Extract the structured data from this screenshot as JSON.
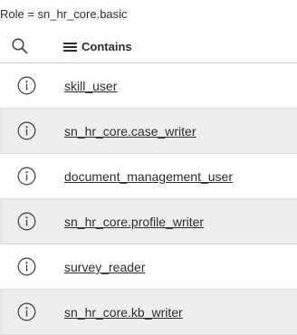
{
  "breadcrumb": {
    "text": "Role = sn_hr_core.basic"
  },
  "header": {
    "search_icon": "search-icon",
    "filter_icon": "hamburger-icon",
    "filter_label": "Contains"
  },
  "rows": [
    {
      "label": "skill_user",
      "icon": "info-icon"
    },
    {
      "label": "sn_hr_core.case_writer",
      "icon": "info-icon"
    },
    {
      "label": "document_management_user",
      "icon": "info-icon"
    },
    {
      "label": "sn_hr_core.profile_writer",
      "icon": "info-icon"
    },
    {
      "label": "survey_reader",
      "icon": "info-icon"
    },
    {
      "label": "sn_hr_core.kb_writer",
      "icon": "info-icon"
    }
  ],
  "colors": {
    "text": "#2e2e2e",
    "row_alt_background": "#eeeeee",
    "row_background": "#ffffff",
    "icon": "#4a4a4a"
  }
}
